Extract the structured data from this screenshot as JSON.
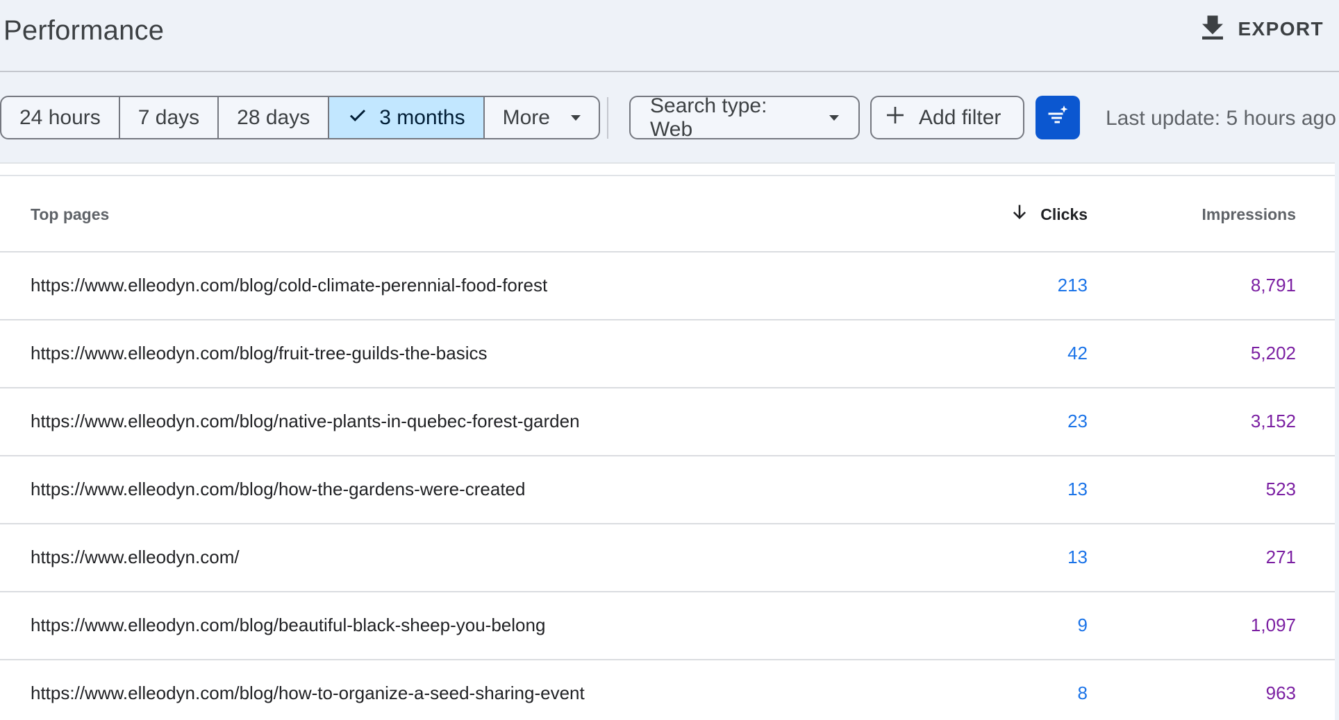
{
  "header": {
    "title": "Performance",
    "export_label": "EXPORT"
  },
  "toolbar": {
    "ranges": [
      {
        "label": "24 hours",
        "selected": false
      },
      {
        "label": "7 days",
        "selected": false
      },
      {
        "label": "28 days",
        "selected": false
      },
      {
        "label": "3 months",
        "selected": true
      },
      {
        "label": "More",
        "selected": false
      }
    ],
    "search_type_label": "Search type: Web",
    "add_filter_label": "Add filter",
    "last_update": "Last update: 5 hours ago"
  },
  "table": {
    "columns": {
      "pages": "Top pages",
      "clicks": "Clicks",
      "impressions": "Impressions"
    },
    "rows": [
      {
        "url": "https://www.elleodyn.com/blog/cold-climate-perennial-food-forest",
        "clicks": "213",
        "impressions": "8,791"
      },
      {
        "url": "https://www.elleodyn.com/blog/fruit-tree-guilds-the-basics",
        "clicks": "42",
        "impressions": "5,202"
      },
      {
        "url": "https://www.elleodyn.com/blog/native-plants-in-quebec-forest-garden",
        "clicks": "23",
        "impressions": "3,152"
      },
      {
        "url": "https://www.elleodyn.com/blog/how-the-gardens-were-created",
        "clicks": "13",
        "impressions": "523"
      },
      {
        "url": "https://www.elleodyn.com/",
        "clicks": "13",
        "impressions": "271"
      },
      {
        "url": "https://www.elleodyn.com/blog/beautiful-black-sheep-you-belong",
        "clicks": "9",
        "impressions": "1,097"
      },
      {
        "url": "https://www.elleodyn.com/blog/how-to-organize-a-seed-sharing-event",
        "clicks": "8",
        "impressions": "963"
      }
    ]
  },
  "colors": {
    "accent": "#0b57d0",
    "selected_chip": "#c2e7ff",
    "clicks": "#1a73e8",
    "impressions": "#7b1fa2"
  }
}
